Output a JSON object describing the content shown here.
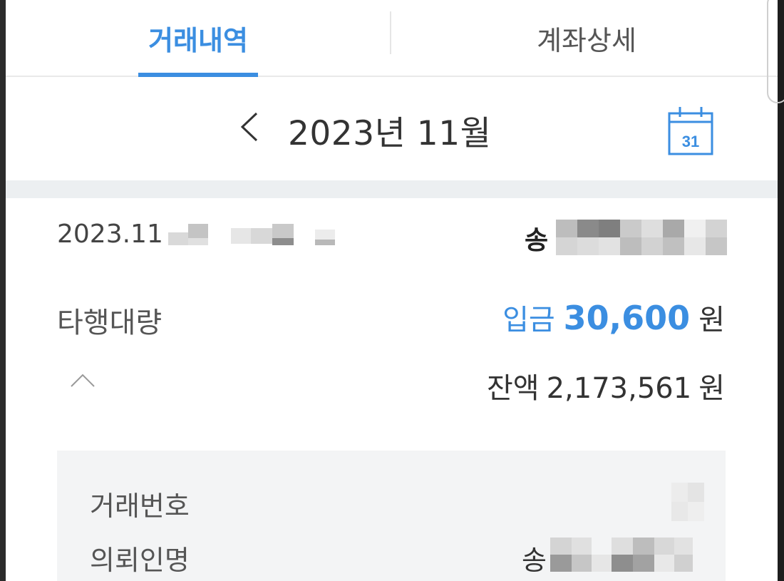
{
  "tabs": {
    "transactions": "거래내역",
    "account_details": "계좌상세"
  },
  "month_nav": {
    "title": "2023년 11월",
    "calendar_day": "31"
  },
  "transaction": {
    "date_prefix": "2023.11",
    "counterparty_prefix": "송",
    "type": "타행대량",
    "deposit_label": "입금",
    "deposit_amount": "30,600",
    "deposit_unit": "원",
    "balance_label": "잔액",
    "balance_amount": "2,173,561",
    "balance_unit": "원"
  },
  "details": {
    "number_label": "거래번호",
    "sender_label": "의뢰인명",
    "sender_prefix": "송"
  },
  "colors": {
    "accent": "#3b8ee1",
    "separator": "#eceff1",
    "detail_bg": "#f3f4f5"
  }
}
